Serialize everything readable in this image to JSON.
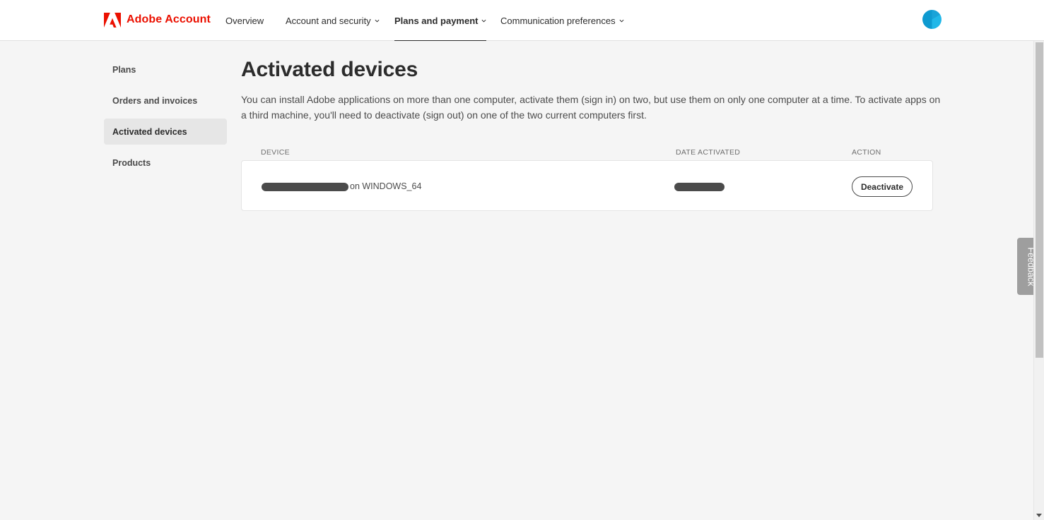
{
  "header": {
    "brand": "Adobe Account",
    "nav": [
      {
        "label": "Overview",
        "dropdown": false,
        "active": false
      },
      {
        "label": "Account and security",
        "dropdown": true,
        "active": false
      },
      {
        "label": "Plans and payment",
        "dropdown": true,
        "active": true
      },
      {
        "label": "Communication preferences",
        "dropdown": true,
        "active": false
      }
    ],
    "brand_color": "#eb1000"
  },
  "sidebar": {
    "items": [
      {
        "label": "Plans",
        "active": false
      },
      {
        "label": "Orders and invoices",
        "active": false
      },
      {
        "label": "Activated devices",
        "active": true
      },
      {
        "label": "Products",
        "active": false
      }
    ]
  },
  "main": {
    "title": "Activated devices",
    "intro": "You can install Adobe applications on more than one computer, activate them (sign in) on two, but use them on only one computer at a time. To activate apps on a third machine, you'll need to deactivate (sign out) on one of the two current computers first.",
    "table": {
      "columns": [
        "DEVICE",
        "DATE ACTIVATED",
        "ACTION"
      ],
      "rows": [
        {
          "device_suffix": "on WINDOWS_64",
          "device_redacted": true,
          "date_redacted": true,
          "action": "Deactivate"
        }
      ]
    }
  },
  "feedback": {
    "label": "Feedback"
  }
}
